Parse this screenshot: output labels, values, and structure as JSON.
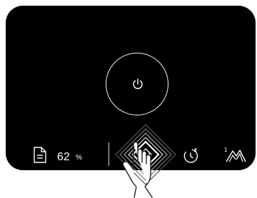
{
  "status": {
    "battery_value": "62",
    "battery_unit": "%",
    "battery_icon": "document-icon"
  },
  "controls": {
    "power_icon": "power-icon",
    "home_icon": "home-icon",
    "timer_icon": "timer-icon",
    "mode_icon": "mountain-mode-icon",
    "mode_level": "1"
  },
  "colors": {
    "panel": "#000000",
    "foreground": "#ffffff",
    "background": "#ffffff"
  }
}
